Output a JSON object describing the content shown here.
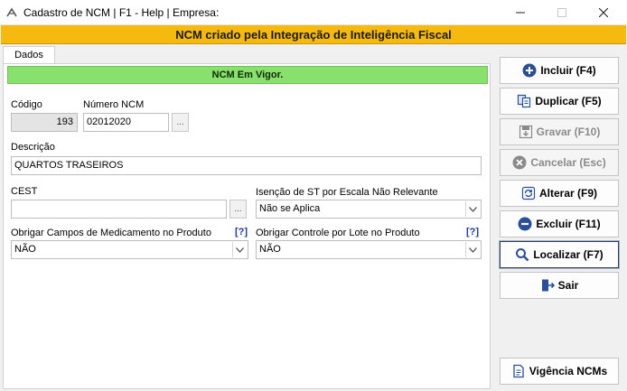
{
  "window": {
    "title": "Cadastro de NCM | F1 - Help | Empresa:"
  },
  "banner": {
    "text": "NCM criado pela Integração de Inteligência Fiscal",
    "color": "#f5b90f"
  },
  "tabs": [
    {
      "label": "Dados",
      "active": true
    }
  ],
  "status": {
    "text": "NCM Em Vigor.",
    "color": "#88e06d"
  },
  "form": {
    "codigo": {
      "label": "Código",
      "value": "193"
    },
    "numero_ncm": {
      "label": "Número NCM",
      "value": "02012020",
      "button": "..."
    },
    "descricao": {
      "label": "Descrição",
      "value": "QUARTOS TRASEIROS"
    },
    "cest": {
      "label": "CEST",
      "value": "",
      "button": "..."
    },
    "isencao_st": {
      "label": "Isenção de ST por Escala Não Relevante",
      "value": "Não se Aplica"
    },
    "obrigar_medicamento": {
      "label": "Obrigar Campos de Medicamento no Produto",
      "help": "[?]",
      "value": "NÃO"
    },
    "obrigar_lote": {
      "label": "Obrigar Controle por Lote no Produto",
      "help": "[?]",
      "value": "NÃO"
    }
  },
  "actions": {
    "incluir": {
      "label": "Incluir (F4)",
      "icon": "plus-circle-icon",
      "enabled": true
    },
    "duplicar": {
      "label": "Duplicar (F5)",
      "icon": "copy-icon",
      "enabled": true
    },
    "gravar": {
      "label": "Gravar (F10)",
      "icon": "save-icon",
      "enabled": false
    },
    "cancelar": {
      "label": "Cancelar (Esc)",
      "icon": "x-circle-icon",
      "enabled": false
    },
    "alterar": {
      "label": "Alterar (F9)",
      "icon": "refresh-icon",
      "enabled": true
    },
    "excluir": {
      "label": "Excluir (F11)",
      "icon": "minus-circle-icon",
      "enabled": true
    },
    "localizar": {
      "label": "Localizar (F7)",
      "icon": "search-icon",
      "enabled": true
    },
    "sair": {
      "label": "Sair",
      "icon": "exit-door-icon",
      "enabled": true
    },
    "vigencia": {
      "label": "Vigência NCMs",
      "icon": "document-icon",
      "enabled": true
    }
  },
  "colors": {
    "accent_blue": "#2a4f9a",
    "disabled_gray": "#8a8a8a"
  }
}
